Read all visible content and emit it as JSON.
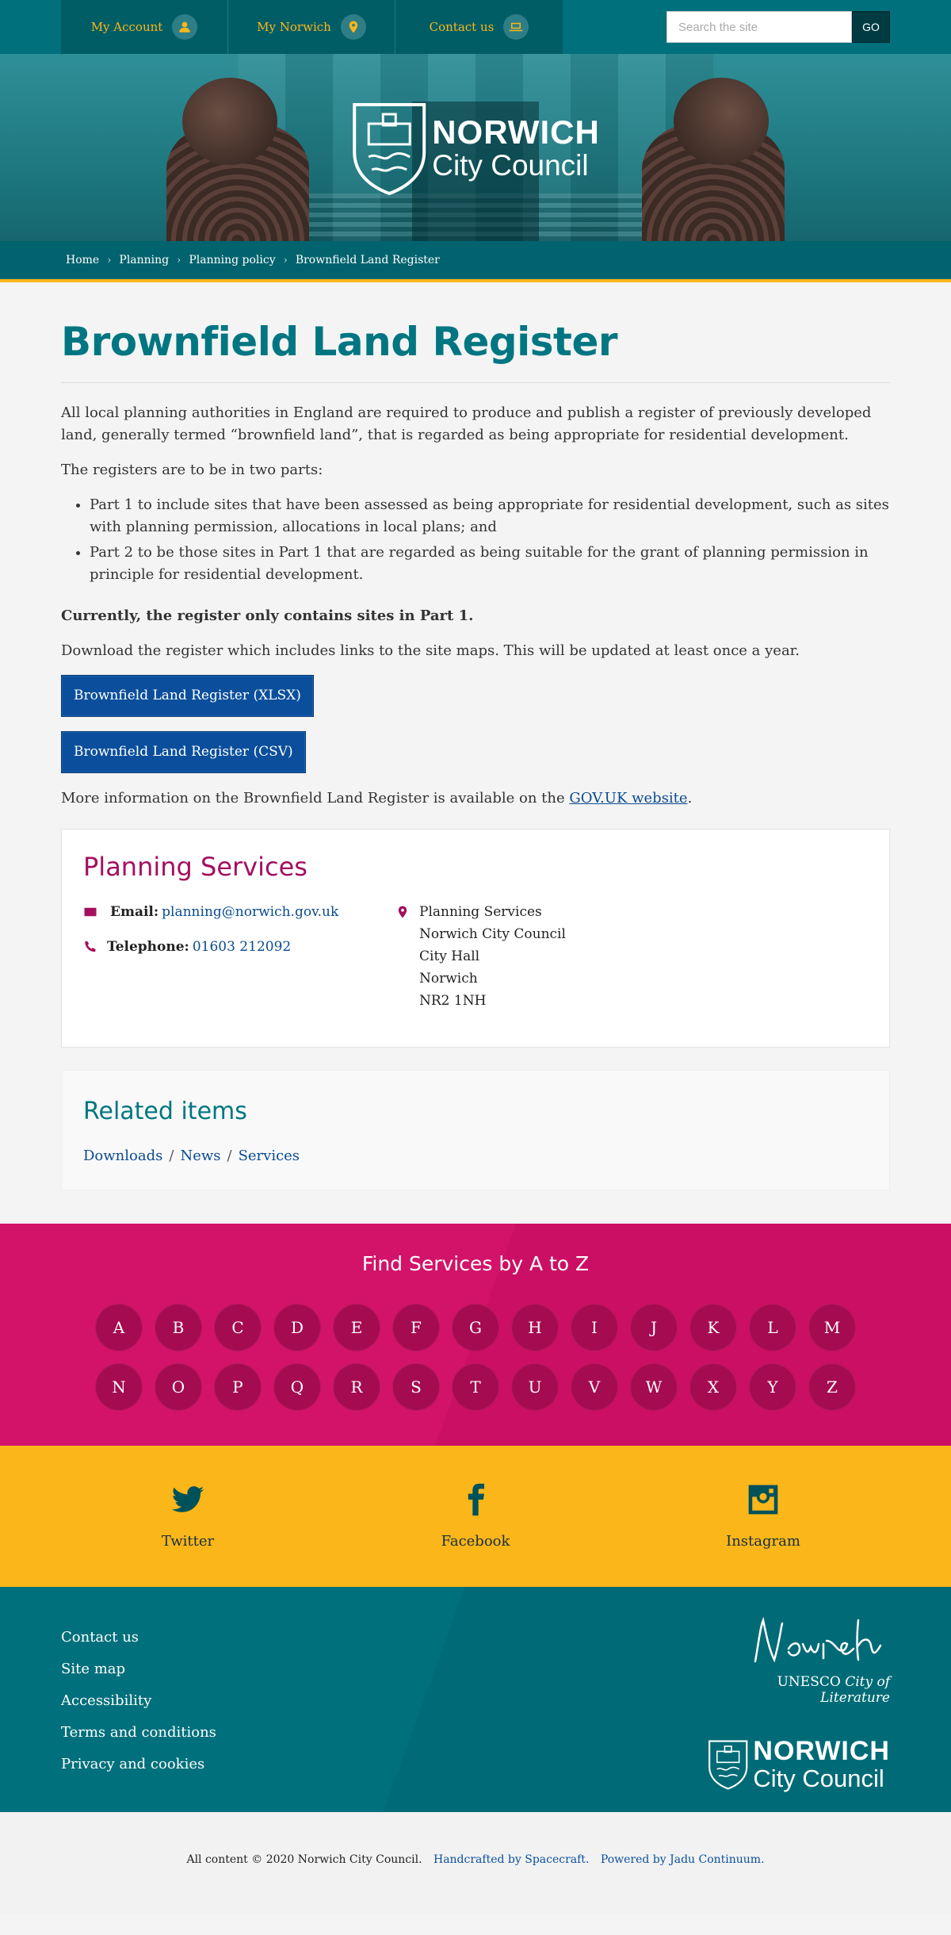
{
  "topnav": {
    "items": [
      {
        "label": "My Account",
        "icon": "user-icon"
      },
      {
        "label": "My Norwich",
        "icon": "map-pin-icon"
      },
      {
        "label": "Contact us",
        "icon": "laptop-icon"
      }
    ]
  },
  "search": {
    "placeholder": "Search the site",
    "button": "GO"
  },
  "logo": {
    "line1": "NORWICH",
    "line2": "City Council"
  },
  "breadcrumb": [
    "Home",
    "Planning",
    "Planning policy",
    "Brownfield Land Register"
  ],
  "page": {
    "title": "Brownfield Land Register",
    "intro": "All local planning authorities in England are required to produce and publish a register of previously developed land, generally termed “brownfield land”, that is regarded as being appropriate for residential development.",
    "parts_intro": "The registers are to be in two parts:",
    "parts": [
      "Part 1 to include sites that have been assessed as being appropriate for residential development, such as sites with planning permission, allocations in local plans; and",
      "Part 2 to be those sites in Part 1 that are regarded as being suitable for the grant of planning permission in principle for residential development."
    ],
    "currently": "Currently, the register only contains sites in Part 1.",
    "download_text": "Download the register which includes links to the site maps. This will be updated at least once a year.",
    "btn_xlsx": "Brownfield Land Register (XLSX)",
    "btn_csv": "Brownfield Land Register (CSV)",
    "more_info_pre": "More information on the Brownfield Land Register is available on the ",
    "more_info_link": "GOV.UK website",
    "more_info_post": "."
  },
  "contact": {
    "title": "Planning Services",
    "email_label": "Email:",
    "email": "planning@norwich.gov.uk",
    "phone_label": "Telephone:",
    "phone": "01603 212092",
    "address": [
      "Planning Services",
      "Norwich City Council",
      "City Hall",
      "Norwich",
      "NR2 1NH"
    ]
  },
  "related": {
    "title": "Related items",
    "links": [
      "Downloads",
      "News",
      "Services"
    ],
    "separator": "/"
  },
  "atoz": {
    "title": "Find Services by A to Z",
    "letters": [
      "A",
      "B",
      "C",
      "D",
      "E",
      "F",
      "G",
      "H",
      "I",
      "J",
      "K",
      "L",
      "M",
      "N",
      "O",
      "P",
      "Q",
      "R",
      "S",
      "T",
      "U",
      "V",
      "W",
      "X",
      "Y",
      "Z"
    ]
  },
  "social": [
    {
      "label": "Twitter",
      "icon": "twitter-icon"
    },
    {
      "label": "Facebook",
      "icon": "facebook-icon"
    },
    {
      "label": "Instagram",
      "icon": "instagram-icon"
    }
  ],
  "footer": {
    "links": [
      "Contact us",
      "Site map",
      "Accessibility",
      "Terms and conditions",
      "Privacy and cookies"
    ],
    "unesco_pre": "UNESCO",
    "unesco_italic": "City of Literature",
    "signature": "Norwich"
  },
  "bottom": {
    "copyright": "All content © 2020 Norwich City Council.",
    "handcrafted": "Handcrafted by Spacecraft.",
    "powered": "Powered by Jadu Continuum."
  },
  "colors": {
    "teal": "#00707c",
    "heading_teal": "#007682",
    "gold": "#fbb61a",
    "magenta": "#d3136a",
    "button_blue": "#0b4f9c"
  }
}
